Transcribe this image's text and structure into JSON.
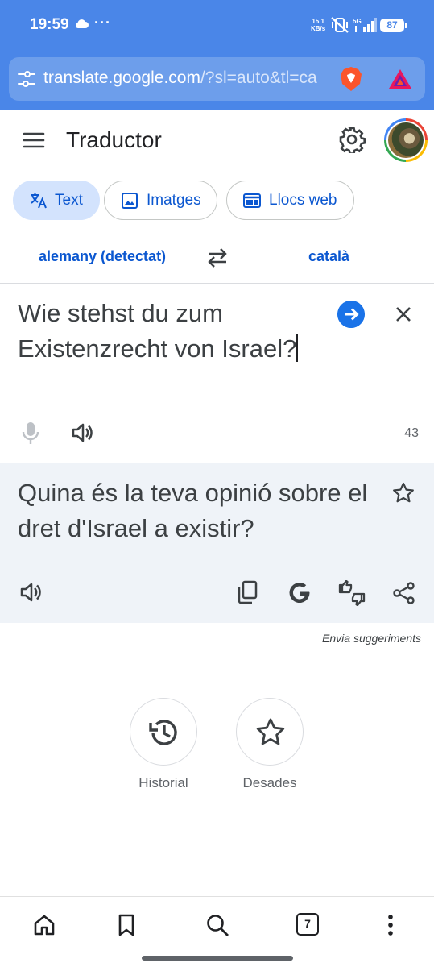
{
  "status_bar": {
    "time": "19:59",
    "dots": "···",
    "speed_top": "15.1",
    "speed_bottom": "KB/s",
    "network": "5G",
    "battery": "87"
  },
  "browser": {
    "url_host": "translate.google.com",
    "url_rest": "/?sl=auto&tl=ca",
    "tab_count": "7"
  },
  "app": {
    "title": "Traductor"
  },
  "modes": {
    "text": "Text",
    "images": "Imatges",
    "websites": "Llocs web"
  },
  "languages": {
    "source": "alemany (detectat)",
    "target": "català"
  },
  "source": {
    "text": "Wie stehst du zum Existenzrecht von Israel?",
    "char_count": "43"
  },
  "result": {
    "text": "Quina és la teva opinió sobre el dret d'Israel a existir?"
  },
  "feedback": {
    "label": "Envia suggeriments"
  },
  "shortcuts": {
    "history": "Historial",
    "saved": "Desades"
  },
  "colors": {
    "accent": "#0b57d0",
    "browser_bar": "#4a86e8",
    "result_bg": "#eff3f8"
  }
}
